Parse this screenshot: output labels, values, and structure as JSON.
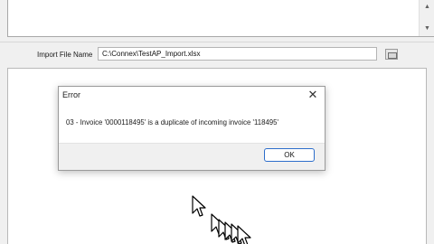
{
  "top_panel": {
    "scroll_up_icon": "▲",
    "scroll_down_icon": "▼"
  },
  "import": {
    "label": "Import File Name",
    "value": "C:\\Connex\\TestAP_Import.xlsx"
  },
  "dialog": {
    "title": "Error",
    "close_icon": "✕",
    "message": "03 - Invoice '0000118495' is a duplicate of incoming invoice '118495'",
    "ok_label": "OK"
  },
  "colors": {
    "accent": "#2d6ecb"
  }
}
